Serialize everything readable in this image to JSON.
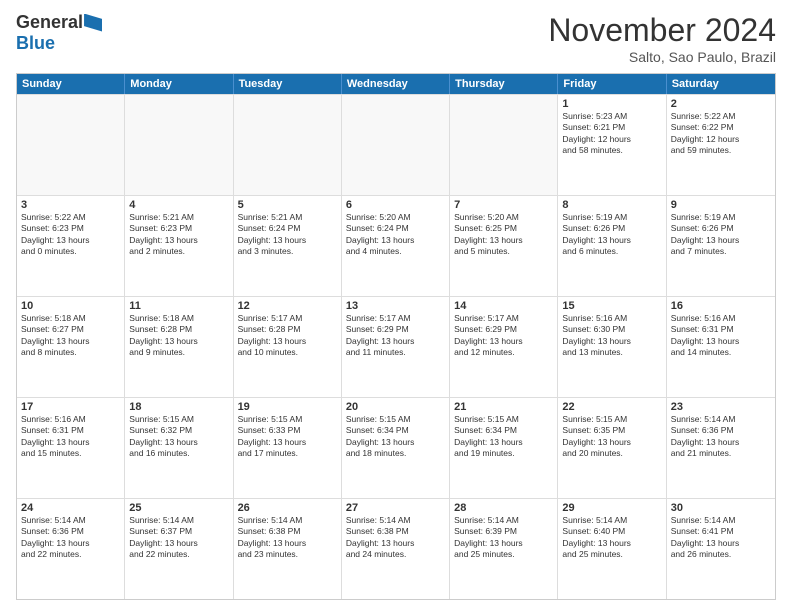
{
  "header": {
    "logo": {
      "line1": "General",
      "line2": "Blue"
    },
    "title": "November 2024",
    "location": "Salto, Sao Paulo, Brazil"
  },
  "days_of_week": [
    "Sunday",
    "Monday",
    "Tuesday",
    "Wednesday",
    "Thursday",
    "Friday",
    "Saturday"
  ],
  "rows": [
    [
      {
        "day": "",
        "empty": true
      },
      {
        "day": "",
        "empty": true
      },
      {
        "day": "",
        "empty": true
      },
      {
        "day": "",
        "empty": true
      },
      {
        "day": "",
        "empty": true
      },
      {
        "day": "1",
        "info": "Sunrise: 5:23 AM\nSunset: 6:21 PM\nDaylight: 12 hours\nand 58 minutes."
      },
      {
        "day": "2",
        "info": "Sunrise: 5:22 AM\nSunset: 6:22 PM\nDaylight: 12 hours\nand 59 minutes."
      }
    ],
    [
      {
        "day": "3",
        "info": "Sunrise: 5:22 AM\nSunset: 6:23 PM\nDaylight: 13 hours\nand 0 minutes."
      },
      {
        "day": "4",
        "info": "Sunrise: 5:21 AM\nSunset: 6:23 PM\nDaylight: 13 hours\nand 2 minutes."
      },
      {
        "day": "5",
        "info": "Sunrise: 5:21 AM\nSunset: 6:24 PM\nDaylight: 13 hours\nand 3 minutes."
      },
      {
        "day": "6",
        "info": "Sunrise: 5:20 AM\nSunset: 6:24 PM\nDaylight: 13 hours\nand 4 minutes."
      },
      {
        "day": "7",
        "info": "Sunrise: 5:20 AM\nSunset: 6:25 PM\nDaylight: 13 hours\nand 5 minutes."
      },
      {
        "day": "8",
        "info": "Sunrise: 5:19 AM\nSunset: 6:26 PM\nDaylight: 13 hours\nand 6 minutes."
      },
      {
        "day": "9",
        "info": "Sunrise: 5:19 AM\nSunset: 6:26 PM\nDaylight: 13 hours\nand 7 minutes."
      }
    ],
    [
      {
        "day": "10",
        "info": "Sunrise: 5:18 AM\nSunset: 6:27 PM\nDaylight: 13 hours\nand 8 minutes."
      },
      {
        "day": "11",
        "info": "Sunrise: 5:18 AM\nSunset: 6:28 PM\nDaylight: 13 hours\nand 9 minutes."
      },
      {
        "day": "12",
        "info": "Sunrise: 5:17 AM\nSunset: 6:28 PM\nDaylight: 13 hours\nand 10 minutes."
      },
      {
        "day": "13",
        "info": "Sunrise: 5:17 AM\nSunset: 6:29 PM\nDaylight: 13 hours\nand 11 minutes."
      },
      {
        "day": "14",
        "info": "Sunrise: 5:17 AM\nSunset: 6:29 PM\nDaylight: 13 hours\nand 12 minutes."
      },
      {
        "day": "15",
        "info": "Sunrise: 5:16 AM\nSunset: 6:30 PM\nDaylight: 13 hours\nand 13 minutes."
      },
      {
        "day": "16",
        "info": "Sunrise: 5:16 AM\nSunset: 6:31 PM\nDaylight: 13 hours\nand 14 minutes."
      }
    ],
    [
      {
        "day": "17",
        "info": "Sunrise: 5:16 AM\nSunset: 6:31 PM\nDaylight: 13 hours\nand 15 minutes."
      },
      {
        "day": "18",
        "info": "Sunrise: 5:15 AM\nSunset: 6:32 PM\nDaylight: 13 hours\nand 16 minutes."
      },
      {
        "day": "19",
        "info": "Sunrise: 5:15 AM\nSunset: 6:33 PM\nDaylight: 13 hours\nand 17 minutes."
      },
      {
        "day": "20",
        "info": "Sunrise: 5:15 AM\nSunset: 6:34 PM\nDaylight: 13 hours\nand 18 minutes."
      },
      {
        "day": "21",
        "info": "Sunrise: 5:15 AM\nSunset: 6:34 PM\nDaylight: 13 hours\nand 19 minutes."
      },
      {
        "day": "22",
        "info": "Sunrise: 5:15 AM\nSunset: 6:35 PM\nDaylight: 13 hours\nand 20 minutes."
      },
      {
        "day": "23",
        "info": "Sunrise: 5:14 AM\nSunset: 6:36 PM\nDaylight: 13 hours\nand 21 minutes."
      }
    ],
    [
      {
        "day": "24",
        "info": "Sunrise: 5:14 AM\nSunset: 6:36 PM\nDaylight: 13 hours\nand 22 minutes."
      },
      {
        "day": "25",
        "info": "Sunrise: 5:14 AM\nSunset: 6:37 PM\nDaylight: 13 hours\nand 22 minutes."
      },
      {
        "day": "26",
        "info": "Sunrise: 5:14 AM\nSunset: 6:38 PM\nDaylight: 13 hours\nand 23 minutes."
      },
      {
        "day": "27",
        "info": "Sunrise: 5:14 AM\nSunset: 6:38 PM\nDaylight: 13 hours\nand 24 minutes."
      },
      {
        "day": "28",
        "info": "Sunrise: 5:14 AM\nSunset: 6:39 PM\nDaylight: 13 hours\nand 25 minutes."
      },
      {
        "day": "29",
        "info": "Sunrise: 5:14 AM\nSunset: 6:40 PM\nDaylight: 13 hours\nand 25 minutes."
      },
      {
        "day": "30",
        "info": "Sunrise: 5:14 AM\nSunset: 6:41 PM\nDaylight: 13 hours\nand 26 minutes."
      }
    ]
  ]
}
